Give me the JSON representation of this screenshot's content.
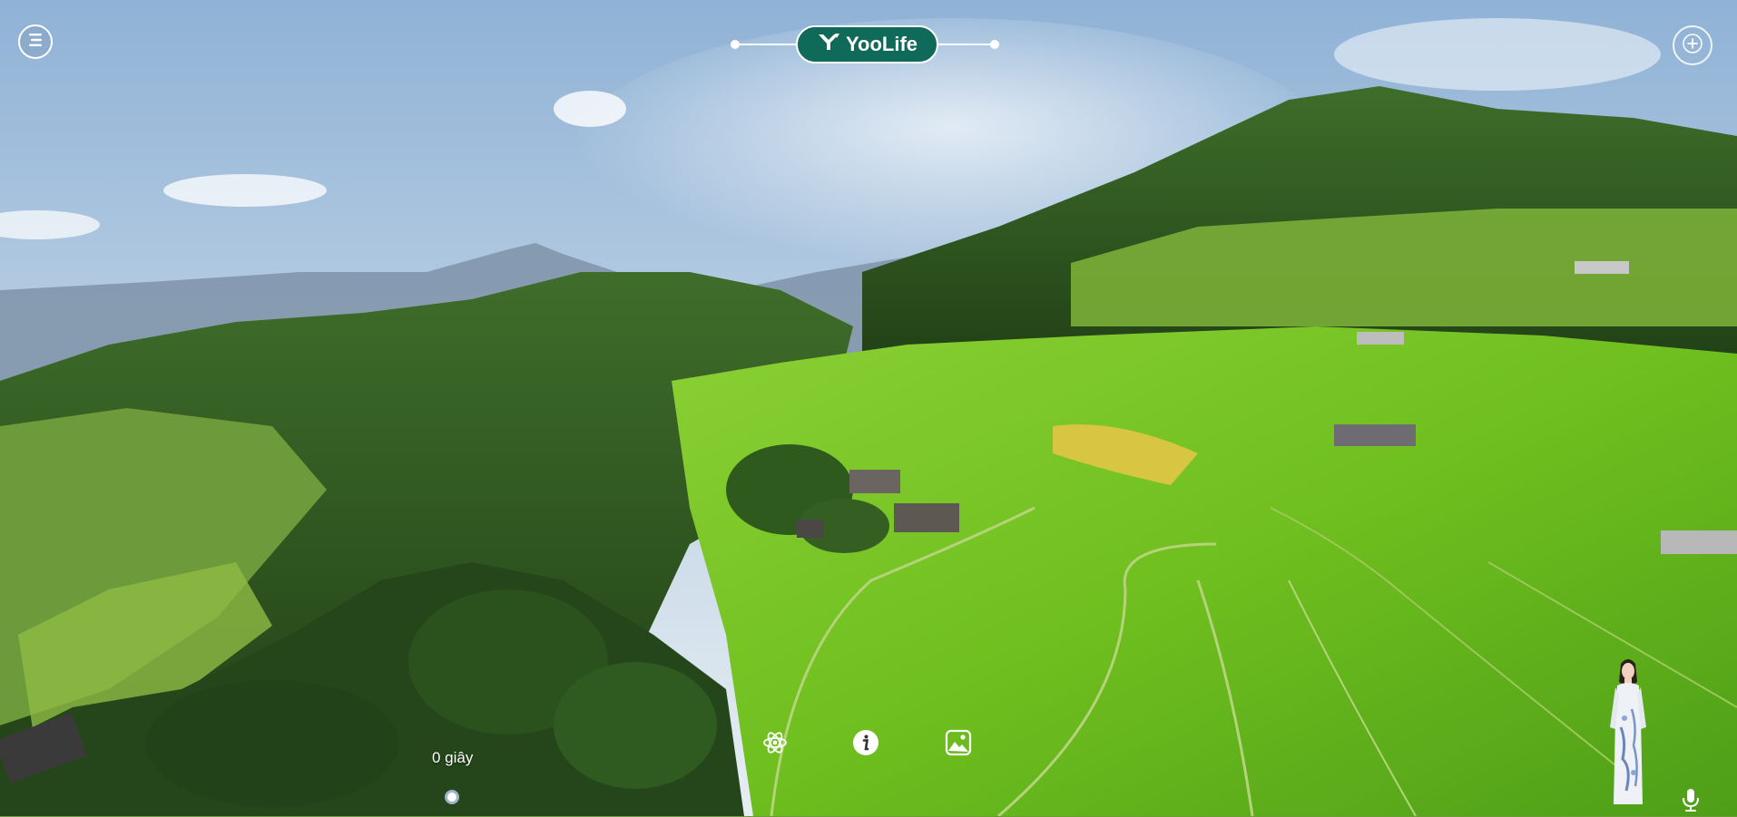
{
  "brand": {
    "name": "YooLife",
    "color": "#0f6a59"
  },
  "timer": {
    "label": "0 giây"
  },
  "toolbar": {
    "items": [
      {
        "icon": "atom-icon",
        "label": ""
      },
      {
        "icon": "info-icon",
        "label": ""
      },
      {
        "icon": "gallery-icon",
        "label": ""
      }
    ]
  },
  "icons": {
    "menu": "menu-icon",
    "add": "plus-icon",
    "mic": "microphone-icon",
    "guide": "virtual-guide-avatar"
  }
}
